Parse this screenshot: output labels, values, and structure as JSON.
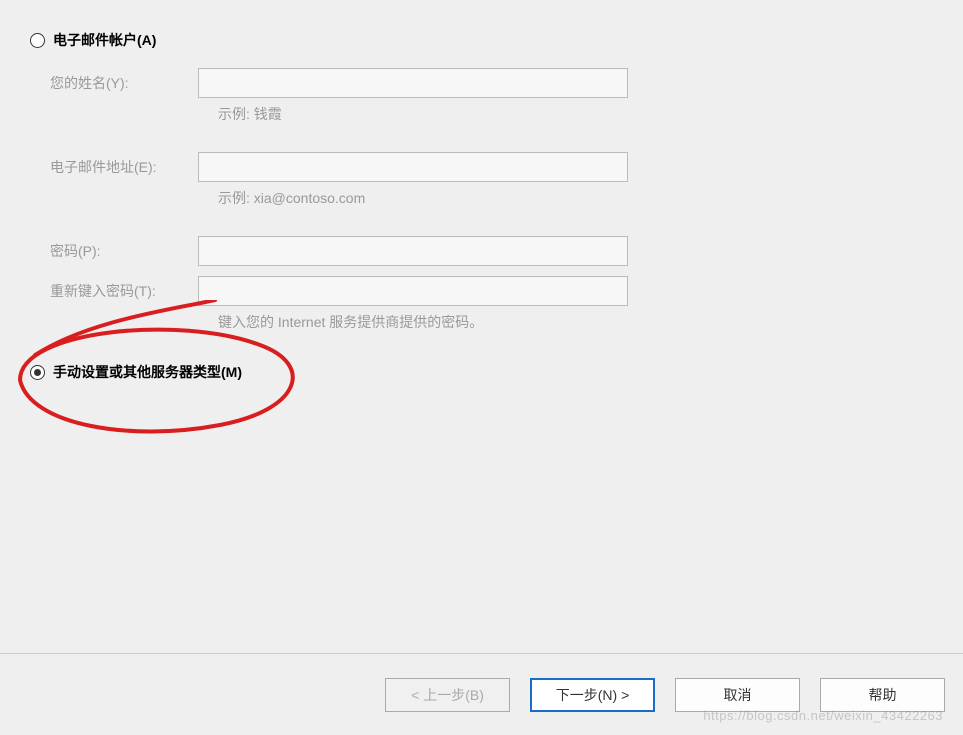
{
  "options": {
    "email_account": {
      "label": "电子邮件帐户(A)",
      "selected": false
    },
    "manual": {
      "label": "手动设置或其他服务器类型(M)",
      "selected": true
    }
  },
  "fields": {
    "name": {
      "label": "您的姓名(Y):",
      "value": "",
      "hint": "示例: 钱霞"
    },
    "email": {
      "label": "电子邮件地址(E):",
      "value": "",
      "hint": "示例: xia@contoso.com"
    },
    "password": {
      "label": "密码(P):",
      "value": ""
    },
    "password_retype": {
      "label": "重新键入密码(T):",
      "value": "",
      "hint": "键入您的 Internet 服务提供商提供的密码。"
    }
  },
  "buttons": {
    "back": "< 上一步(B)",
    "next": "下一步(N) >",
    "cancel": "取消",
    "help": "帮助"
  },
  "watermark": "https://blog.csdn.net/weixin_43422263"
}
